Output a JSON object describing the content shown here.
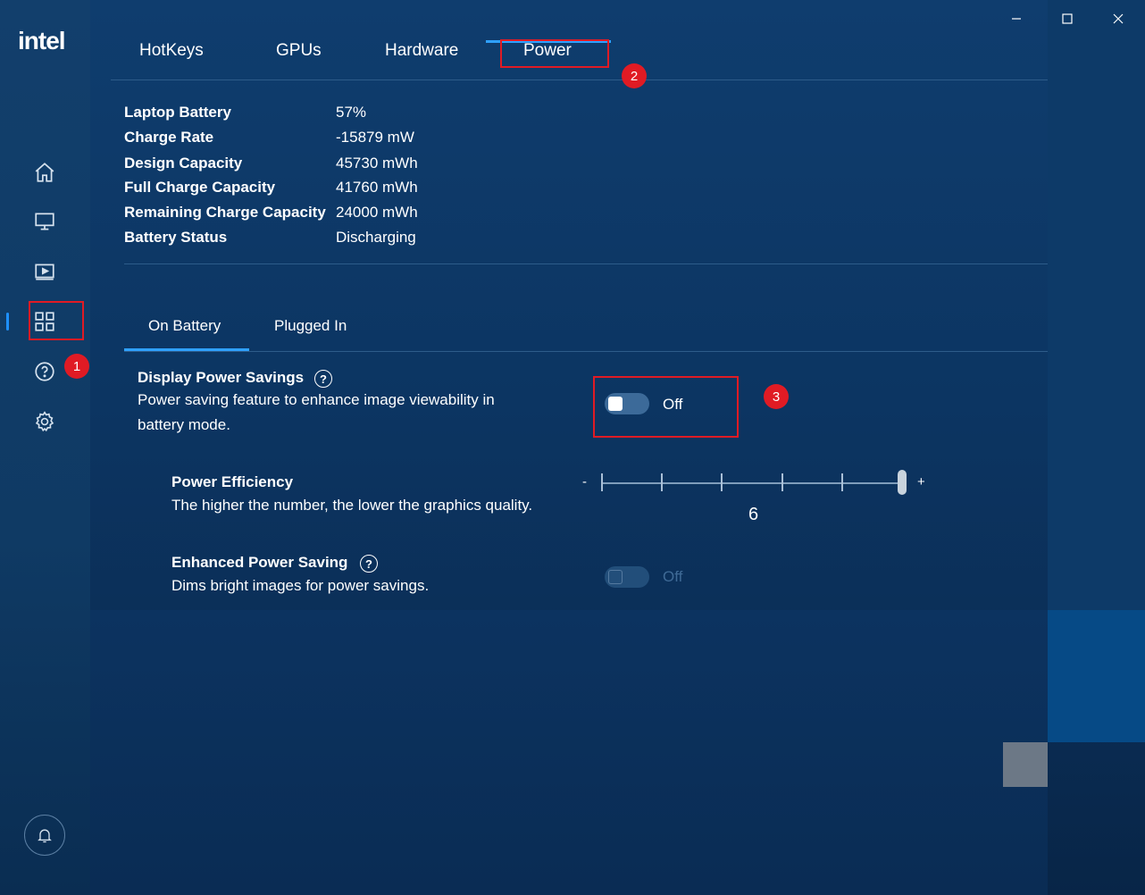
{
  "app": {
    "logo": "intel"
  },
  "tabs": [
    {
      "label": "HotKeys"
    },
    {
      "label": "GPUs"
    },
    {
      "label": "Hardware"
    },
    {
      "label": "Power"
    }
  ],
  "active_tab": "Power",
  "battery_info": [
    {
      "label": "Laptop Battery",
      "value": "57%"
    },
    {
      "label": "Charge Rate",
      "value": "-15879 mW"
    },
    {
      "label": "Design Capacity",
      "value": "45730 mWh"
    },
    {
      "label": "Full Charge Capacity",
      "value": "41760 mWh"
    },
    {
      "label": "Remaining Charge Capacity",
      "value": "24000 mWh"
    },
    {
      "label": "Battery Status",
      "value": "Discharging"
    }
  ],
  "subtabs": [
    {
      "label": "On Battery"
    },
    {
      "label": "Plugged In"
    }
  ],
  "active_subtab": "On Battery",
  "display_power_savings": {
    "title": "Display Power Savings",
    "description": "Power saving feature to enhance image viewability in battery mode.",
    "toggle_state": "Off",
    "help_glyph": "?"
  },
  "power_efficiency": {
    "title": "Power Efficiency",
    "description": "The higher the number, the lower the graphics quality.",
    "min_symbol": "-",
    "max_symbol": "+",
    "value": "6"
  },
  "enhanced_power_saving": {
    "title": "Enhanced Power Saving",
    "description": "Dims bright images for power savings.",
    "toggle_state": "Off",
    "help_glyph": "?"
  },
  "annotations": {
    "badge1": "1",
    "badge2": "2",
    "badge3": "3"
  },
  "sidebar_icons": [
    "home-icon",
    "display-icon",
    "video-icon",
    "apps-grid-icon",
    "help-icon",
    "settings-gear-icon"
  ],
  "colors": {
    "accent": "#2fa0ff",
    "annotation_red": "#e01b24",
    "background": "#0c3562"
  }
}
